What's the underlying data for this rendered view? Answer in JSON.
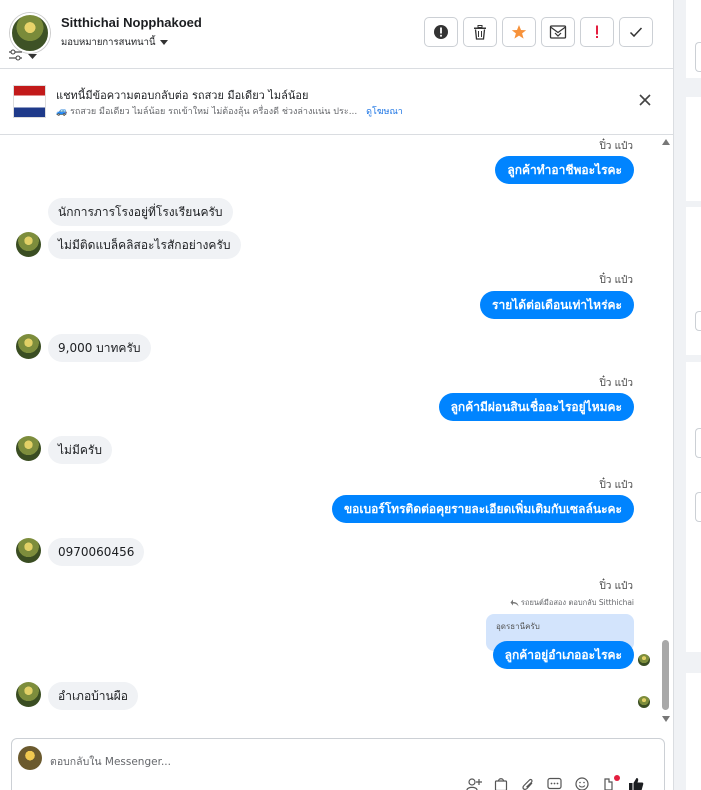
{
  "header": {
    "user_name": "Sitthichai Nopphakoed",
    "assign_label": "มอบหมายการสนทนานี้",
    "actions": [
      {
        "name": "spam-report",
        "icon": "exclamation-circle-icon"
      },
      {
        "name": "delete",
        "icon": "trash-icon"
      },
      {
        "name": "star",
        "icon": "star-icon"
      },
      {
        "name": "mark-unread",
        "icon": "envelope-x-icon"
      },
      {
        "name": "priority",
        "icon": "exclamation-icon"
      },
      {
        "name": "done",
        "icon": "check-icon"
      }
    ]
  },
  "ad_bar": {
    "title": "แชทนี้มีข้อความตอบกลับต่อ รถสวย มือเดียว ไมล์น้อย",
    "subtitle": "🚙 รถสวย มือเดียว ไมล์น้อย รถเข้าใหม่ ไม่ต้องลุ้น ครื่องดี ช่วงล่างแน่น ประ...",
    "link": "ดูโฆษณา"
  },
  "messages": [
    {
      "sender": "ปิ๋ว แป๋ว",
      "text": "ลูกค้าทำอาชีพอะไรคะ"
    },
    {
      "text": "นักการภารโรงอยู่ที่โรงเรียนครับ"
    },
    {
      "text": "ไม่มีติดแบล็คลิสอะไรสักอย่างครับ"
    },
    {
      "sender": "ปิ๋ว แป๋ว",
      "text": "รายได้ต่อเดือนเท่าไหร่คะ"
    },
    {
      "text": "9,000 บาทครับ"
    },
    {
      "sender": "ปิ๋ว แป๋ว",
      "text": "ลูกค้ามีผ่อนสินเชื่ออะไรอยู่ไหมคะ"
    },
    {
      "text": "ไม่มีครับ"
    },
    {
      "sender": "ปิ๋ว แป๋ว",
      "text": "ขอเบอร์โทรติดต่อคุยรายละเอียดเพิ่มเติมกับเซลล์นะคะ"
    },
    {
      "text": "0970060456"
    },
    {
      "sender": "ปิ๋ว แป๋ว",
      "reply_note": "รถยนต์มือสอง ตอบกลับ Sitthichai",
      "quote": "อุดรธานีครับ",
      "text": "ลูกค้าอยู่อำเภออะไรคะ"
    },
    {
      "text": "อำเภอบ้านผือ"
    }
  ],
  "composer": {
    "placeholder": "ตอบกลับใน Messenger..."
  },
  "colors": {
    "accent": "#0084ff",
    "incoming_bg": "#f0f2f5",
    "star": "#f7923a",
    "priority": "#e41e3f"
  }
}
